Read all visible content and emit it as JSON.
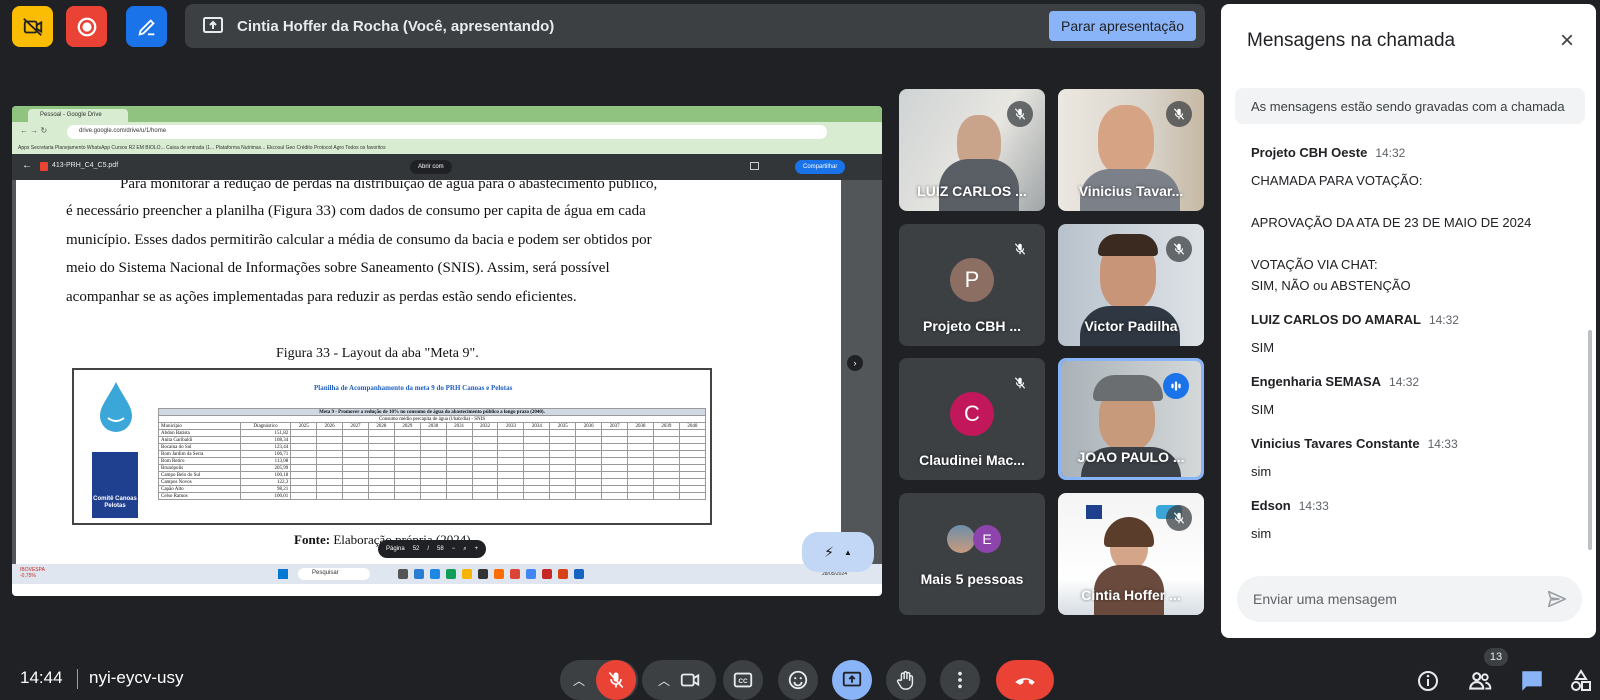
{
  "top_bar": {
    "presenter_text": "Cintia Hoffer da Rocha (Você, apresentando)",
    "stop_button": "Parar apresentação"
  },
  "shared_screen": {
    "browser_tab": "Pessoal - Google Drive",
    "url": "drive.google.com/drive/u/1/home",
    "bookmarks": "Apps   Secretaria Planejamento   WhatsApp   Cursos R2 EM BIOLO...   Caixa de entrada (1...   Plataforma Nutrimax...   Ekcosul   Geo Crédito   Protocol Agro                                                                  Todos os favoritos",
    "pdf_name": "413-PRH_C4_C5.pdf",
    "open_with": "Abrir com",
    "share": "Compartilhar",
    "paragraph": [
      "Para monitorar a redução de perdas na distribuição de água para o abastecimento público,",
      "é necessário preencher a planilha (Figura 33) com dados de consumo per capita de água em cada",
      "município. Esses dados permitirão calcular a média de consumo da bacia e podem ser obtidos por",
      "meio do Sistema Nacional de Informações sobre Saneamento (SNIS). Assim, será possível",
      "acompanhar se as ações implementadas para reduzir as perdas estão sendo eficientes."
    ],
    "figure_title": "Figura 33 - Layout da aba \"Meta 9\".",
    "figure_heading": "Planilha de Acompanhamento da meta 9 do PRH Canoas e Pelotas",
    "figure_logo_label": "Comitê Canoas Pelotas",
    "table_title": "Meta 9 - Promover a redução de 10% no consumo de água do abastecimento público a longo prazo (2040).",
    "table_subtitle": "Consumo médio percapita de água  (l/hab/dia) - SNIS",
    "table_columns": [
      "Município",
      "Diagnóstico",
      "2025",
      "2026",
      "2027",
      "2028",
      "2029",
      "2030",
      "2031",
      "2032",
      "2033",
      "2034",
      "2035",
      "2036",
      "2037",
      "2038",
      "2039",
      "2040"
    ],
    "table_rows": [
      [
        "Abdon Batista",
        "151,82"
      ],
      [
        "Anita Garibaldi",
        "108,34"
      ],
      [
        "Bocaina do Sul",
        "123,44"
      ],
      [
        "Bom Jardim da Serra",
        "106,71"
      ],
      [
        "Bom Retiro",
        "113,08"
      ],
      [
        "Brunópolis",
        "205,99"
      ],
      [
        "Campo Belo do Sul",
        "100,18"
      ],
      [
        "Campos Novos",
        "122,3"
      ],
      [
        "Capão Alto",
        "98,21"
      ],
      [
        "Celso Ramos",
        "100,01"
      ]
    ],
    "source_label": "Fonte:",
    "source_text": "Elaboração própria (2024).",
    "page_label": "Página",
    "page_current": "52",
    "page_total": "58",
    "taskbar_search": "Pesquisar",
    "weather": "IBOVESPA -0,75%",
    "taskbar_date": "28/05/2024"
  },
  "participants": [
    {
      "name": "LUIZ CARLOS ...",
      "muted": true,
      "type": "video"
    },
    {
      "name": "Vinicius Tavar...",
      "muted": true,
      "type": "video"
    },
    {
      "name": "Projeto CBH ...",
      "muted": true,
      "type": "avatar",
      "initial": "P",
      "color": "#8d6e63"
    },
    {
      "name": "Victor Padilha",
      "muted": true,
      "type": "video"
    },
    {
      "name": "Claudinei Mac...",
      "muted": true,
      "type": "avatar",
      "initial": "C",
      "color": "#c2185b"
    },
    {
      "name": "JOAO PAULO ...",
      "muted": false,
      "type": "video",
      "speaking": true
    },
    {
      "name": "Mais 5 pessoas",
      "type": "more",
      "initial": "E"
    },
    {
      "name": "Cintia Hoffer ...",
      "muted": true,
      "type": "video"
    }
  ],
  "chat": {
    "title": "Mensagens na chamada",
    "recording_note": "As mensagens estão sendo gravadas com a chamada",
    "messages": [
      {
        "sender": "Projeto CBH Oeste",
        "time": "14:32",
        "text": "CHAMADA PARA VOTAÇÃO:\n\nAPROVAÇÃO DA ATA DE 23 DE MAIO DE 2024\n\nVOTAÇÃO VIA CHAT:\nSIM, NÃO ou ABSTENÇÃO"
      },
      {
        "sender": "LUIZ CARLOS DO AMARAL",
        "time": "14:32",
        "text": "SIM"
      },
      {
        "sender": "Engenharia SEMASA",
        "time": "14:32",
        "text": "SIM"
      },
      {
        "sender": "Vinicius Tavares Constante",
        "time": "14:33",
        "text": "sim"
      },
      {
        "sender": "Edson",
        "time": "14:33",
        "text": "sim"
      }
    ],
    "input_placeholder": "Enviar uma mensagem"
  },
  "bottom_bar": {
    "time": "14:44",
    "meeting_code": "nyi-eycv-usy",
    "people_count": "13"
  },
  "colors": {
    "background": "#202124",
    "end_call": "#ea4335",
    "accent_blue": "#8ab4f8",
    "active_share": "#8ab4f8"
  }
}
